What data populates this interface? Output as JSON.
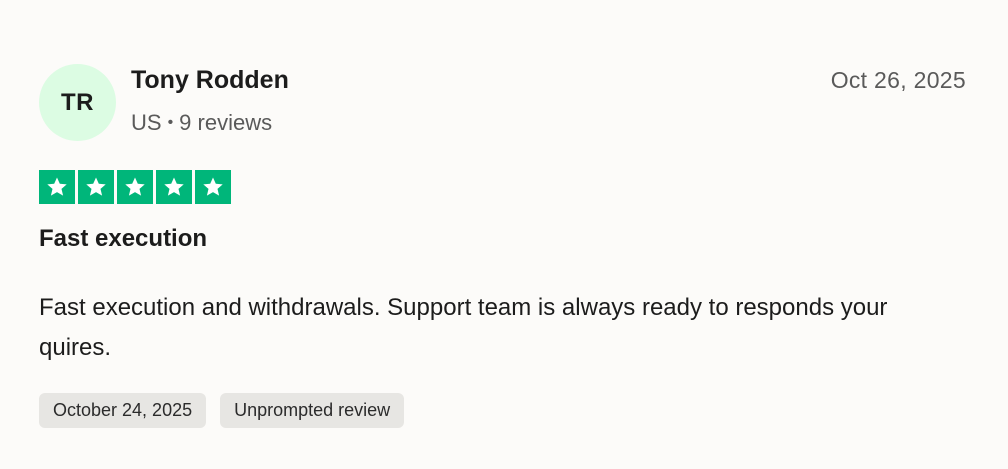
{
  "reviewer": {
    "initials": "TR",
    "name": "Tony Rodden",
    "country": "US",
    "separator": "•",
    "review_count": "9 reviews",
    "avatar_color": "#dcfce3"
  },
  "review": {
    "date": "Oct 26, 2025",
    "rating": 5,
    "rating_max": 5,
    "star_icon": "star-icon",
    "star_color": "#00b67a",
    "title": "Fast execution",
    "body": "Fast execution and withdrawals. Support team is always ready to responds your quires.",
    "tags": {
      "experience_date": "October 24, 2025",
      "review_type": "Unprompted review"
    }
  }
}
